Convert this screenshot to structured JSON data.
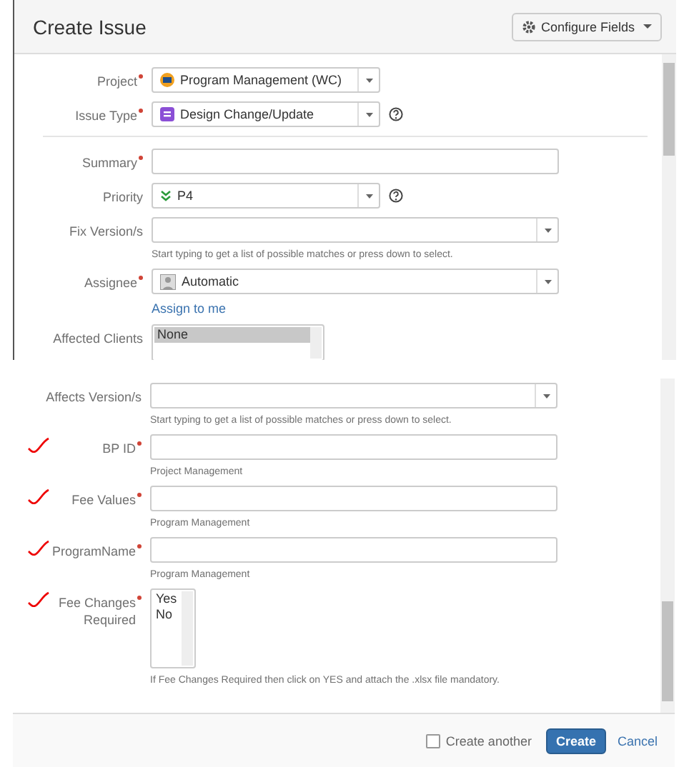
{
  "dialog": {
    "title": "Create Issue",
    "configure_button": "Configure Fields"
  },
  "top_fields": [
    {
      "kind": "project-select",
      "label": "Project",
      "required": true,
      "value": "Program Management (WC)",
      "help": false
    },
    {
      "kind": "type-select",
      "label": "Issue Type",
      "required": true,
      "value": "Design Change/Update",
      "help": true
    },
    {
      "kind": "divider"
    },
    {
      "kind": "text",
      "label": "Summary",
      "required": true
    },
    {
      "kind": "priority-select",
      "label": "Priority",
      "required": false,
      "value": "P4",
      "help": true
    },
    {
      "kind": "version-select",
      "label": "Fix Version/s",
      "required": false,
      "hint": "Start typing to get a list of possible matches or press down to select."
    },
    {
      "kind": "user-select",
      "label": "Assignee",
      "required": true,
      "value": "Automatic",
      "link": "Assign to me"
    },
    {
      "kind": "listbox",
      "label": "Affected Clients",
      "required": false,
      "options": [
        {
          "label": "None",
          "selected": true
        }
      ]
    }
  ],
  "bottom_fields": [
    {
      "kind": "version-select",
      "label": "Affects Version/s",
      "required": false,
      "hint": "Start typing to get a list of possible matches or press down to select.",
      "annotated": false
    },
    {
      "kind": "text",
      "label": "BP ID",
      "required": true,
      "hint": "Project Management",
      "annotated": true
    },
    {
      "kind": "text",
      "label": "Fee Values",
      "required": true,
      "hint": "Program Management",
      "annotated": true
    },
    {
      "kind": "text",
      "label": "ProgramName",
      "required": true,
      "hint": "Program Management",
      "annotated": true
    },
    {
      "kind": "listbox",
      "label": "Fee Changes Required",
      "required": true,
      "options": [
        {
          "label": "Yes",
          "selected": false
        },
        {
          "label": "No",
          "selected": false
        }
      ],
      "hint": "If Fee Changes Required then click on YES and attach the .xlsx file mandatory.",
      "annotated": true
    }
  ],
  "footer": {
    "create_another": {
      "label": "Create another",
      "checked": false
    },
    "submit": "Create",
    "cancel": "Cancel"
  }
}
